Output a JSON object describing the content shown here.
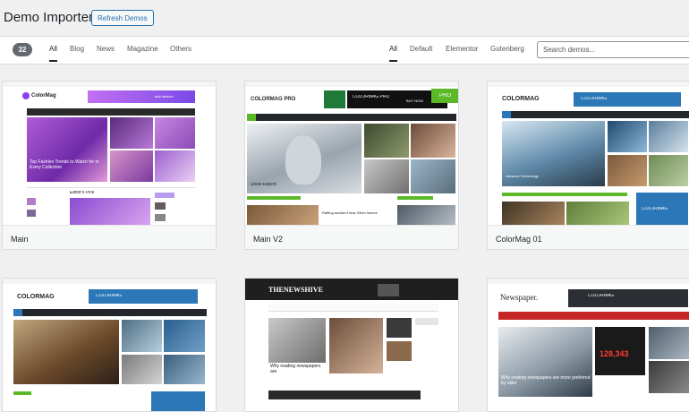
{
  "header": {
    "title": "Demo Importer",
    "refresh_label": "Refresh Demos"
  },
  "filters": {
    "count": "32",
    "categories": [
      "All",
      "Blog",
      "News",
      "Magazine",
      "Others"
    ],
    "builders": [
      "All",
      "Default",
      "Elementor",
      "Gutenberg"
    ],
    "search_placeholder": "Search demos..."
  },
  "demos": [
    {
      "name": "Main",
      "thumb": {
        "logo": "ColorMag",
        "ad": "ada fashion",
        "headline": "Top Fashion Trends to Watch for in Every Collection",
        "section": "Editor's Pick"
      }
    },
    {
      "name": "Main V2",
      "thumb": {
        "logo": "COLORMAG PRO",
        "banner": "COLORMAG PRO",
        "badge": "PRO",
        "buy": "BUY NOW",
        "headline": "Snow Report",
        "story": "Rafting accident near Silver leaves"
      }
    },
    {
      "name": "ColorMag 01",
      "thumb": {
        "logo": "COLORMAG",
        "banner": "COLORMAG",
        "headline": "Advance Technology",
        "banner2": "COLORMAG"
      }
    },
    {
      "name": "",
      "thumb": {
        "logo": "COLORMAG",
        "banner": "COLORMAG",
        "headline": ""
      }
    },
    {
      "name": "",
      "thumb": {
        "logo": "THENEWSHIVE",
        "headline": "Why reading newspapers are"
      }
    },
    {
      "name": "",
      "thumb": {
        "logo": "Newspaper.",
        "banner": "COLORMAG",
        "stat": "128,343",
        "headline": "Why reading newspapers are more preferred by older"
      }
    }
  ],
  "colors": {
    "accent": "#2271b1",
    "count_badge": "#646970",
    "pro_green": "#5bb928",
    "cm_blue": "#2b77b8"
  }
}
